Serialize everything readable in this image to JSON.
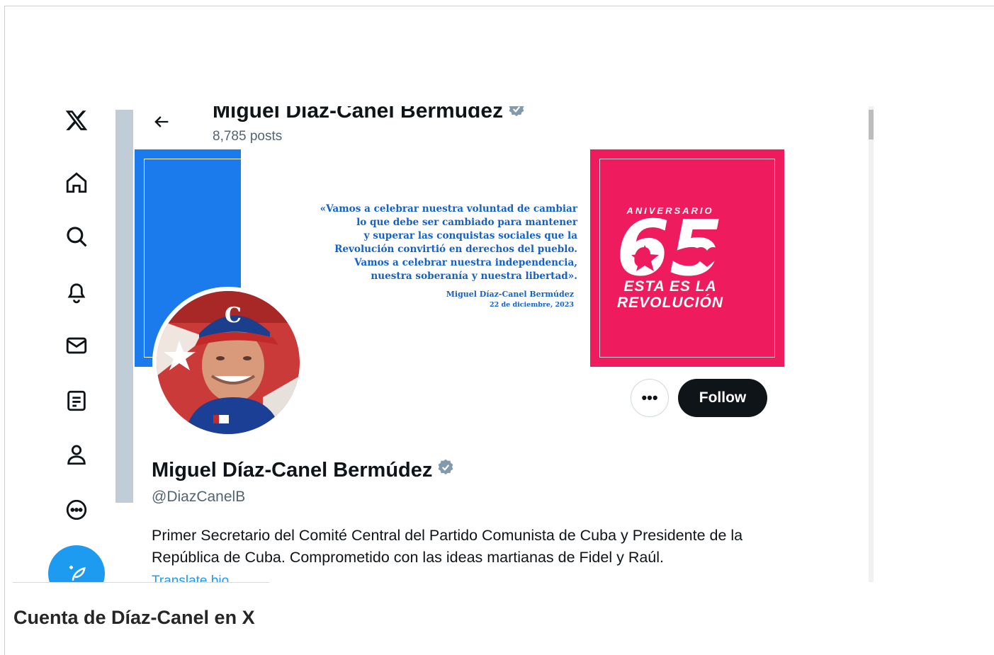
{
  "nav": {
    "icons": [
      "x-logo-icon",
      "home-icon",
      "search-icon",
      "notifications-icon",
      "messages-icon",
      "lists-icon",
      "profile-icon",
      "more-icon",
      "compose-icon"
    ]
  },
  "header": {
    "back_icon": "arrow-left-icon",
    "name": "Miguel Díaz-Canel Bermúdez",
    "posts": "8,785 posts"
  },
  "banner": {
    "quote_lines": [
      "«Vamos a celebrar nuestra voluntad de cambiar",
      "lo que debe ser cambiado para mantener",
      "y superar las conquistas sociales que la",
      "Revolución convirtió en derechos del pueblo.",
      "Vamos a celebrar nuestra independencia,",
      "nuestra soberanía y nuestra libertad»."
    ],
    "quote_author": "Miguel Díaz-Canel Bermúdez",
    "quote_date": "22 de diciembre, 2023",
    "aniversario": "ANIVERSARIO",
    "number": "65",
    "esta_line1": "ESTA ES LA",
    "esta_line2": "REVOLUCIÓN"
  },
  "profile": {
    "more_label": "•••",
    "follow_label": "Follow",
    "name": "Miguel Díaz-Canel Bermúdez",
    "handle": "@DiazCanelB",
    "bio": "Primer Secretario del Comité Central del Partido Comunista de Cuba y Presidente de la República de Cuba. Comprometido con las ideas martianas de Fidel y Raúl.",
    "translate": "Translate bio"
  },
  "caption": "Cuenta de Díaz-Canel en X",
  "colors": {
    "accent": "#1d9bf0",
    "banner_blue": "#1c7bec",
    "banner_red": "#ee1c5f",
    "verified_badge": "#829aab"
  }
}
